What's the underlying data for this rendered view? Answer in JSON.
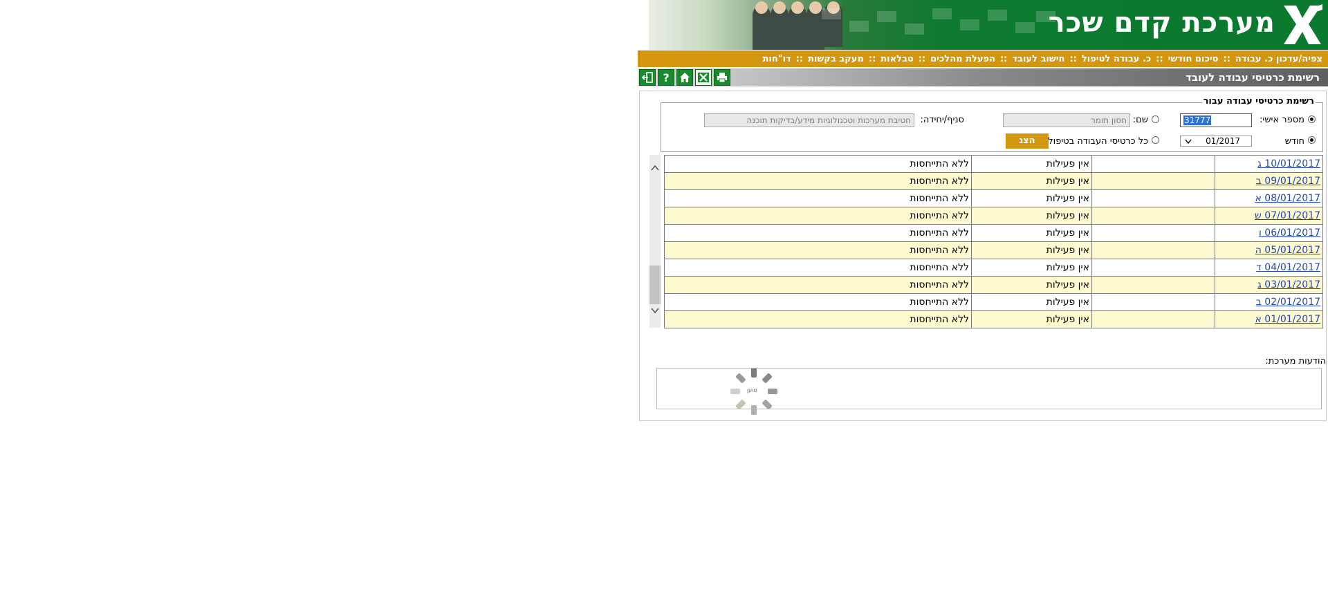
{
  "app": {
    "title": "מערכת קדם שכר",
    "logo_text": "X"
  },
  "menu": [
    "צפיה/עדכון כ. עבודה",
    "סיכום חודשי",
    "כ. עבודה לטיפול",
    "חישוב לעובד",
    "הפעלת מהלכים",
    "טבלאות",
    "מעקב בקשות",
    "דו\"חות"
  ],
  "menu_separator": "::",
  "page": {
    "title": "רשימת כרטיסי עבודה לעובד",
    "toolbar_icons": [
      "exit-icon",
      "help-icon",
      "home-icon",
      "excel-icon",
      "print-icon"
    ]
  },
  "form": {
    "legend": "רשימת כרטיסי עבודה עבור",
    "employee_id_label": "מספר אישי:",
    "employee_id_value": "31777",
    "name_label": "שם:",
    "name_value": "חסון תומר",
    "branch_label": "סניף/יחידה:",
    "branch_value": "חטיבת מערכות וטכנולוגיות מידע/בדיקות תוכנה",
    "month_label": "חודש",
    "month_value": "01/2017",
    "all_cards_label": "כל כרטיסי העבודה בטיפול",
    "show_button": "הצג",
    "selected_search": "employee_id",
    "selected_scope": "month"
  },
  "rows": [
    {
      "date": "10/01/2017",
      "day": "ג",
      "col2": "",
      "activity": "אין פעילות",
      "status": "ללא התייחסות"
    },
    {
      "date": "09/01/2017",
      "day": "ב",
      "col2": "",
      "activity": "אין פעילות",
      "status": "ללא התייחסות"
    },
    {
      "date": "08/01/2017",
      "day": "א",
      "col2": "",
      "activity": "אין פעילות",
      "status": "ללא התייחסות"
    },
    {
      "date": "07/01/2017",
      "day": "ש",
      "col2": "",
      "activity": "אין פעילות",
      "status": "ללא התייחסות"
    },
    {
      "date": "06/01/2017",
      "day": "ו",
      "col2": "",
      "activity": "אין פעילות",
      "status": "ללא התייחסות"
    },
    {
      "date": "05/01/2017",
      "day": "ה",
      "col2": "",
      "activity": "אין פעילות",
      "status": "ללא התייחסות"
    },
    {
      "date": "04/01/2017",
      "day": "ד",
      "col2": "",
      "activity": "אין פעילות",
      "status": "ללא התייחסות"
    },
    {
      "date": "03/01/2017",
      "day": "ג",
      "col2": "",
      "activity": "אין פעילות",
      "status": "ללא התייחסות"
    },
    {
      "date": "02/01/2017",
      "day": "ב",
      "col2": "",
      "activity": "אין פעילות",
      "status": "ללא התייחסות"
    },
    {
      "date": "01/01/2017",
      "day": "א",
      "col2": "",
      "activity": "אין פעילות",
      "status": "ללא התייחסות"
    }
  ],
  "loading_text": "טוען",
  "messages": {
    "label": "הודעות מערכת:",
    "content": ""
  },
  "colors": {
    "brand_green": "#0a7a2e",
    "menu_gold": "#d4960f",
    "row_alt": "#fdfad0",
    "link": "#2246b8"
  }
}
